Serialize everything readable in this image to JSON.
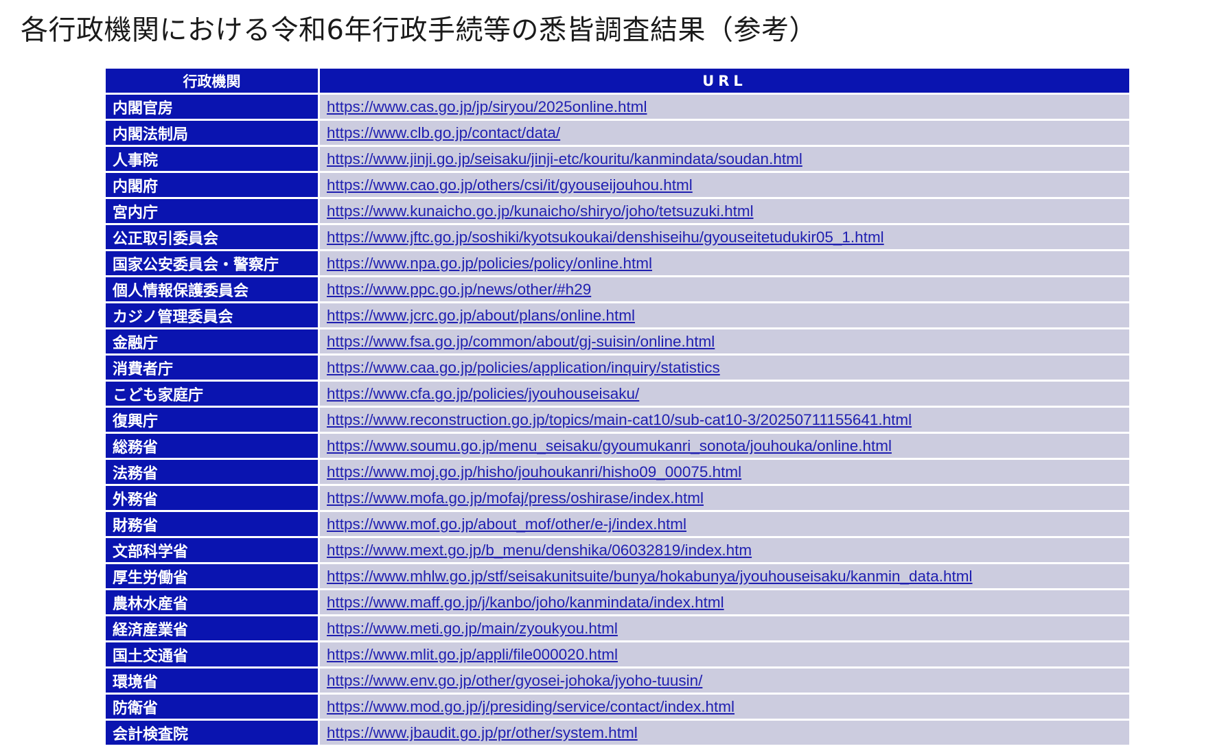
{
  "page": {
    "title": "各行政機関における令和6年行政手続等の悉皆調査結果（参考）"
  },
  "table": {
    "headers": {
      "agency": "行政機関",
      "url": "URL"
    },
    "rows": [
      {
        "agency": "内閣官房",
        "url": "https://www.cas.go.jp/jp/siryou/2025online.html"
      },
      {
        "agency": "内閣法制局",
        "url": "https://www.clb.go.jp/contact/data/"
      },
      {
        "agency": "人事院",
        "url": "https://www.jinji.go.jp/seisaku/jinji-etc/kouritu/kanmindata/soudan.html"
      },
      {
        "agency": "内閣府",
        "url": "https://www.cao.go.jp/others/csi/it/gyouseijouhou.html"
      },
      {
        "agency": "宮内庁",
        "url": "https://www.kunaicho.go.jp/kunaicho/shiryo/joho/tetsuzuki.html"
      },
      {
        "agency": "公正取引委員会",
        "url": "https://www.jftc.go.jp/soshiki/kyotsukoukai/denshiseihu/gyouseitetudukir05_1.html"
      },
      {
        "agency": "国家公安委員会・警察庁",
        "url": "https://www.npa.go.jp/policies/policy/online.html"
      },
      {
        "agency": "個人情報保護委員会",
        "url": "https://www.ppc.go.jp/news/other/#h29"
      },
      {
        "agency": "カジノ管理委員会",
        "url": "https://www.jcrc.go.jp/about/plans/online.html"
      },
      {
        "agency": "金融庁",
        "url": "https://www.fsa.go.jp/common/about/gj-suisin/online.html"
      },
      {
        "agency": "消費者庁",
        "url": "https://www.caa.go.jp/policies/application/inquiry/statistics"
      },
      {
        "agency": "こども家庭庁",
        "url": "https://www.cfa.go.jp/policies/jyouhouseisaku/"
      },
      {
        "agency": "復興庁",
        "url": "https://www.reconstruction.go.jp/topics/main-cat10/sub-cat10-3/20250711155641.html"
      },
      {
        "agency": "総務省",
        "url": "https://www.soumu.go.jp/menu_seisaku/gyoumukanri_sonota/jouhouka/online.html"
      },
      {
        "agency": "法務省",
        "url": "https://www.moj.go.jp/hisho/jouhoukanri/hisho09_00075.html"
      },
      {
        "agency": "外務省",
        "url": "https://www.mofa.go.jp/mofaj/press/oshirase/index.html"
      },
      {
        "agency": "財務省",
        "url": "https://www.mof.go.jp/about_mof/other/e-j/index.html"
      },
      {
        "agency": "文部科学省",
        "url": "https://www.mext.go.jp/b_menu/denshika/06032819/index.htm"
      },
      {
        "agency": "厚生労働省",
        "url": "https://www.mhlw.go.jp/stf/seisakunitsuite/bunya/hokabunya/jyouhouseisaku/kanmin_data.html"
      },
      {
        "agency": "農林水産省",
        "url": "https://www.maff.go.jp/j/kanbo/joho/kanmindata/index.html"
      },
      {
        "agency": "経済産業省",
        "url": "https://www.meti.go.jp/main/zyoukyou.html"
      },
      {
        "agency": "国土交通省",
        "url": "https://www.mlit.go.jp/appli/file000020.html"
      },
      {
        "agency": "環境省",
        "url": "https://www.env.go.jp/other/gyosei-johoka/jyoho-tuusin/"
      },
      {
        "agency": "防衛省",
        "url": "https://www.mod.go.jp/j/presiding/service/contact/index.html"
      },
      {
        "agency": "会計検査院",
        "url": "https://www.jbaudit.go.jp/pr/other/system.html"
      }
    ]
  }
}
